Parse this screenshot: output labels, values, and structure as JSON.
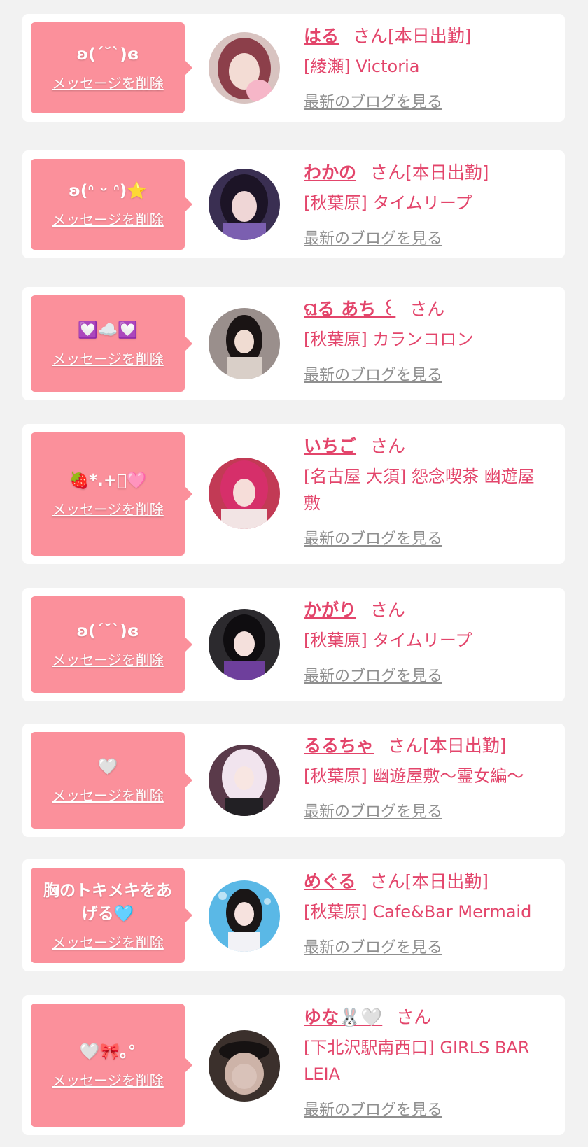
{
  "delete_label": "メッセージを削除",
  "blog_label": "最新のブログを見る",
  "colors": {
    "bubble": "#fb909b",
    "name": "#e3456b",
    "link_gray": "#8f8f8f",
    "background": "#f2f2f2"
  },
  "entries": [
    {
      "message": "ʚ(ˊ˘ˋ)ɞ",
      "name": "はる",
      "suffix": "さん[本日出勤]",
      "shop": "[綾瀬] Victoria",
      "avatar_icon": "avatar-photo"
    },
    {
      "message": "ʚ(ᐢ ᵕ ᐢ)⭐",
      "name": "わかの",
      "suffix": "さん[本日出勤]",
      "shop": "[秋葉原] タイムリープ",
      "avatar_icon": "avatar-photo"
    },
    {
      "message": "💟☁️💟",
      "name": "ଘる あち ꒰",
      "suffix": "さん",
      "shop": "[秋葉原] カランコロン",
      "avatar_icon": "avatar-photo"
    },
    {
      "message": "🍓*.+ﾟ🩷",
      "name": "いちご",
      "suffix": "さん",
      "shop": "[名古屋 大須] 怨念喫茶 幽遊屋敷",
      "avatar_icon": "avatar-photo"
    },
    {
      "message": "ʚ(ˊ˘ˋ)ɞ",
      "name": "かがり",
      "suffix": "さん",
      "shop": "[秋葉原] タイムリープ",
      "avatar_icon": "avatar-photo"
    },
    {
      "message": "🤍",
      "name": "るるちゃ",
      "suffix": "さん[本日出勤]",
      "shop": "[秋葉原] 幽遊屋敷〜霊女編〜",
      "avatar_icon": "avatar-photo"
    },
    {
      "message": "胸のトキメキをあげる🩵",
      "name": "めぐる",
      "suffix": "さん[本日出勤]",
      "shop": "[秋葉原] Cafe&Bar Mermaid",
      "avatar_icon": "avatar-photo"
    },
    {
      "message": "🤍🎀｡°",
      "name": "ゆな🐰🤍",
      "suffix": "さん",
      "shop": "[下北沢駅南西口] GIRLS BAR LEIA",
      "avatar_icon": "avatar-photo"
    }
  ]
}
